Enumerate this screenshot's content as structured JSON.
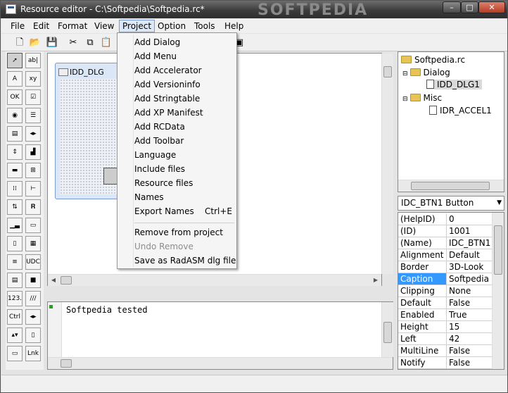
{
  "window": {
    "title": "Resource editor - C:\\Softpedia\\Softpedia.rc*",
    "watermark": "SOFTPEDIA",
    "min_glyph": "–",
    "max_glyph": "□",
    "close_glyph": "✕"
  },
  "menubar": [
    "File",
    "Edit",
    "Format",
    "View",
    "Project",
    "Option",
    "Tools",
    "Help"
  ],
  "toolbar": [
    {
      "name": "new-file-icon",
      "glyph": "🗋"
    },
    {
      "name": "open-folder-icon",
      "glyph": "📂"
    },
    {
      "name": "save-icon",
      "glyph": "💾"
    },
    {
      "name": "cut-icon",
      "glyph": "✂"
    },
    {
      "name": "copy-icon",
      "glyph": "⧉"
    },
    {
      "name": "paste-icon",
      "glyph": "📋"
    },
    {
      "name": "preview-icon",
      "glyph": "▣"
    }
  ],
  "palette": [
    {
      "name": "pointer-tool",
      "glyph": "➚"
    },
    {
      "name": "edittext-tool",
      "glyph": "ab|"
    },
    {
      "name": "static-text-tool",
      "glyph": "A"
    },
    {
      "name": "groupbox-tool",
      "glyph": "xy"
    },
    {
      "name": "button-tool",
      "glyph": "OK"
    },
    {
      "name": "checkbox-tool",
      "glyph": "☑"
    },
    {
      "name": "radio-tool",
      "glyph": "◉"
    },
    {
      "name": "listbox-tool",
      "glyph": "☰"
    },
    {
      "name": "combobox-tool",
      "glyph": "▤"
    },
    {
      "name": "hscroll-tool",
      "glyph": "◂▸"
    },
    {
      "name": "updown-tool",
      "glyph": "⇕"
    },
    {
      "name": "image-tool",
      "glyph": "▟"
    },
    {
      "name": "progress-tool",
      "glyph": "▬"
    },
    {
      "name": "treeview-tool",
      "glyph": "⊞"
    },
    {
      "name": "listview-tool",
      "glyph": "⁞⁞"
    },
    {
      "name": "trackbar-tool",
      "glyph": "⊢"
    },
    {
      "name": "spin-tool",
      "glyph": "⇅"
    },
    {
      "name": "animate-tool",
      "glyph": "𝐑"
    },
    {
      "name": "rebar-tool",
      "glyph": "▁▃"
    },
    {
      "name": "statusbar-tool",
      "glyph": "▭"
    },
    {
      "name": "tab-tool",
      "glyph": "▯"
    },
    {
      "name": "grid-tool",
      "glyph": "▦"
    },
    {
      "name": "richedit-tool",
      "glyph": "≡"
    },
    {
      "name": "udc-tool",
      "glyph": "UDC"
    },
    {
      "name": "datetime-tool",
      "glyph": "▤"
    },
    {
      "name": "shape-tool",
      "glyph": "■"
    },
    {
      "name": "ipaddress-tool",
      "glyph": "123."
    },
    {
      "name": "hotkey-tool",
      "glyph": "///"
    },
    {
      "name": "ctrl-tool",
      "glyph": "Ctrl"
    },
    {
      "name": "arrows-tool",
      "glyph": "◂▸"
    },
    {
      "name": "vscroll-tool",
      "glyph": "▴▾"
    },
    {
      "name": "rect-tool",
      "glyph": "▯"
    },
    {
      "name": "mdi-tool",
      "glyph": "▭"
    },
    {
      "name": "link-tool",
      "glyph": "Lnk"
    }
  ],
  "dialog": {
    "caption": "IDD_DLG"
  },
  "project_menu": [
    {
      "label": "Add Dialog"
    },
    {
      "label": "Add Menu"
    },
    {
      "label": "Add Accelerator"
    },
    {
      "label": "Add Versioninfo"
    },
    {
      "label": "Add Stringtable"
    },
    {
      "label": "Add XP Manifest"
    },
    {
      "label": "Add RCData"
    },
    {
      "label": "Add Toolbar"
    },
    {
      "label": "Language"
    },
    {
      "label": "Include files"
    },
    {
      "label": "Resource files"
    },
    {
      "label": "Names"
    },
    {
      "label": "Export Names",
      "shortcut": "Ctrl+E"
    },
    {
      "label": "Remove from project"
    },
    {
      "label": "Undo Remove",
      "disabled": true
    },
    {
      "label": "Save as RadASM dlg file"
    }
  ],
  "output": {
    "text": "Softpedia tested"
  },
  "tree": [
    "Softpedia.rc",
    "Dialog",
    "IDD_DLG1",
    "Misc",
    "IDR_ACCEL1"
  ],
  "control_select": "IDC_BTN1 Button",
  "properties": [
    [
      "(HelpID)",
      "0"
    ],
    [
      "(ID)",
      "1001"
    ],
    [
      "(Name)",
      "IDC_BTN1"
    ],
    [
      "Alignment",
      "Default"
    ],
    [
      "Border",
      "3D-Look"
    ],
    [
      "Caption",
      "Softpedia"
    ],
    [
      "Clipping",
      "None"
    ],
    [
      "Default",
      "False"
    ],
    [
      "Enabled",
      "True"
    ],
    [
      "Height",
      "15"
    ],
    [
      "Left",
      "42"
    ],
    [
      "MultiLine",
      "False"
    ],
    [
      "Notify",
      "False"
    ]
  ],
  "selected_property": "Caption"
}
